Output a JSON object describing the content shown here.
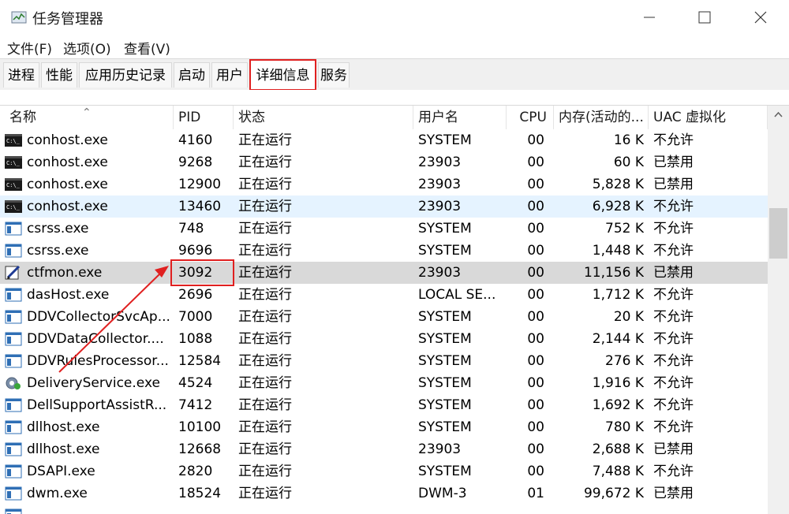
{
  "window": {
    "title": "任务管理器",
    "controls": {
      "minimize": "minimize-icon",
      "maximize": "maximize-icon",
      "close": "close-icon"
    }
  },
  "menu": [
    "文件(F)",
    "选项(O)",
    "查看(V)"
  ],
  "tabs": [
    {
      "label": "进程"
    },
    {
      "label": "性能"
    },
    {
      "label": "应用历史记录"
    },
    {
      "label": "启动"
    },
    {
      "label": "用户"
    },
    {
      "label": "详细信息",
      "active": true
    },
    {
      "label": "服务"
    }
  ],
  "columns": [
    "名称",
    "PID",
    "状态",
    "用户名",
    "CPU",
    "内存(活动的...",
    "UAC 虚拟化"
  ],
  "rows": [
    {
      "name": "conhost.exe",
      "pid": "4160",
      "status": "正在运行",
      "user": "SYSTEM",
      "cpu": "00",
      "mem": "16 K",
      "uac": "不允许",
      "icon": "console-icon"
    },
    {
      "name": "conhost.exe",
      "pid": "9268",
      "status": "正在运行",
      "user": "23903",
      "cpu": "00",
      "mem": "60 K",
      "uac": "已禁用",
      "icon": "console-icon"
    },
    {
      "name": "conhost.exe",
      "pid": "12900",
      "status": "正在运行",
      "user": "23903",
      "cpu": "00",
      "mem": "5,828 K",
      "uac": "已禁用",
      "icon": "console-icon"
    },
    {
      "name": "conhost.exe",
      "pid": "13460",
      "status": "正在运行",
      "user": "23903",
      "cpu": "00",
      "mem": "6,928 K",
      "uac": "不允许",
      "icon": "console-icon",
      "state": "hover"
    },
    {
      "name": "csrss.exe",
      "pid": "748",
      "status": "正在运行",
      "user": "SYSTEM",
      "cpu": "00",
      "mem": "752 K",
      "uac": "不允许",
      "icon": "window-app-icon"
    },
    {
      "name": "csrss.exe",
      "pid": "9696",
      "status": "正在运行",
      "user": "SYSTEM",
      "cpu": "00",
      "mem": "1,448 K",
      "uac": "不允许",
      "icon": "window-app-icon"
    },
    {
      "name": "ctfmon.exe",
      "pid": "3092",
      "status": "正在运行",
      "user": "23903",
      "cpu": "00",
      "mem": "11,156 K",
      "uac": "已禁用",
      "icon": "pen-icon",
      "state": "selected"
    },
    {
      "name": "dasHost.exe",
      "pid": "2696",
      "status": "正在运行",
      "user": "LOCAL SE...",
      "cpu": "00",
      "mem": "1,712 K",
      "uac": "不允许",
      "icon": "window-app-icon"
    },
    {
      "name": "DDVCollectorSvcAp...",
      "pid": "7000",
      "status": "正在运行",
      "user": "SYSTEM",
      "cpu": "00",
      "mem": "20 K",
      "uac": "不允许",
      "icon": "window-app-icon"
    },
    {
      "name": "DDVDataCollector....",
      "pid": "1088",
      "status": "正在运行",
      "user": "SYSTEM",
      "cpu": "00",
      "mem": "2,144 K",
      "uac": "不允许",
      "icon": "window-app-icon"
    },
    {
      "name": "DDVRulesProcessor...",
      "pid": "12584",
      "status": "正在运行",
      "user": "SYSTEM",
      "cpu": "00",
      "mem": "276 K",
      "uac": "不允许",
      "icon": "window-app-icon"
    },
    {
      "name": "DeliveryService.exe",
      "pid": "4524",
      "status": "正在运行",
      "user": "SYSTEM",
      "cpu": "00",
      "mem": "1,916 K",
      "uac": "不允许",
      "icon": "gear-icon"
    },
    {
      "name": "DellSupportAssistR...",
      "pid": "7412",
      "status": "正在运行",
      "user": "SYSTEM",
      "cpu": "00",
      "mem": "1,692 K",
      "uac": "不允许",
      "icon": "window-app-icon"
    },
    {
      "name": "dllhost.exe",
      "pid": "10100",
      "status": "正在运行",
      "user": "SYSTEM",
      "cpu": "00",
      "mem": "780 K",
      "uac": "不允许",
      "icon": "window-app-icon"
    },
    {
      "name": "dllhost.exe",
      "pid": "12668",
      "status": "正在运行",
      "user": "23903",
      "cpu": "00",
      "mem": "2,688 K",
      "uac": "已禁用",
      "icon": "window-app-icon"
    },
    {
      "name": "DSAPI.exe",
      "pid": "2820",
      "status": "正在运行",
      "user": "SYSTEM",
      "cpu": "00",
      "mem": "7,488 K",
      "uac": "不允许",
      "icon": "window-app-icon"
    },
    {
      "name": "dwm.exe",
      "pid": "18524",
      "status": "正在运行",
      "user": "DWM-3",
      "cpu": "01",
      "mem": "99,672 K",
      "uac": "已禁用",
      "icon": "window-app-icon"
    },
    {
      "name": "",
      "pid": "",
      "status": "",
      "user": "",
      "cpu": "",
      "mem": "",
      "uac": "",
      "icon": "window-app-icon",
      "partial": true
    }
  ],
  "colors": {
    "annotation": "#e02020",
    "hover_row": "#e5f3ff",
    "selected_row": "#d9d9d9"
  }
}
